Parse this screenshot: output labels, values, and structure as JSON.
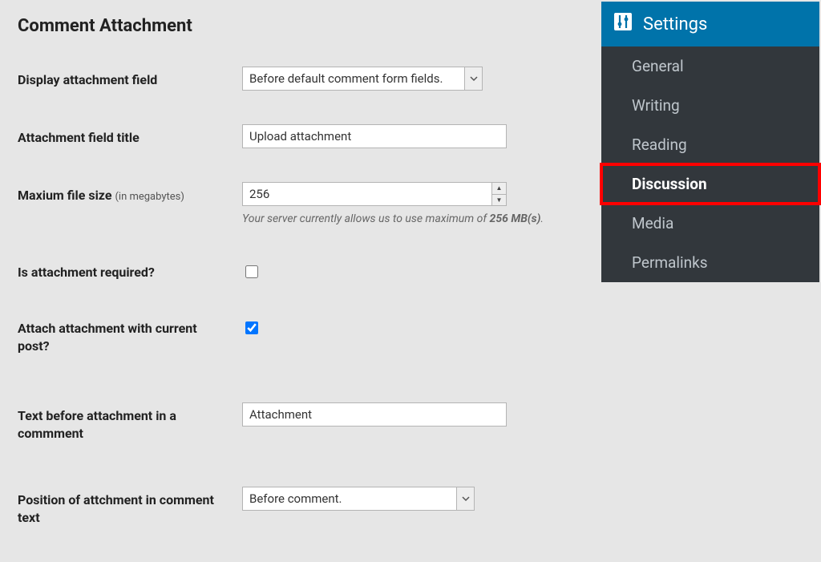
{
  "page_title": "Comment Attachment",
  "fields": {
    "display_field": {
      "label": "Display attachment field",
      "selected": "Before default comment form fields."
    },
    "field_title": {
      "label": "Attachment field title",
      "value": "Upload attachment"
    },
    "max_size": {
      "label": "Maxium file size",
      "sublabel": "(in megabytes)",
      "value": "256",
      "help_prefix": "Your server currently allows us to use maximum of ",
      "help_bold": "256 MB(s)",
      "help_suffix": "."
    },
    "required": {
      "label": "Is attachment required?",
      "checked": false
    },
    "attach_post": {
      "label": "Attach attachment with current post?",
      "checked": true
    },
    "text_before": {
      "label": "Text before attachment in a commment",
      "value": "Attachment"
    },
    "position": {
      "label": "Position of attchment in comment text",
      "selected": "Before comment."
    }
  },
  "sidebar": {
    "header": "Settings",
    "items": [
      {
        "label": "General",
        "highlighted": false
      },
      {
        "label": "Writing",
        "highlighted": false
      },
      {
        "label": "Reading",
        "highlighted": false
      },
      {
        "label": "Discussion",
        "highlighted": true
      },
      {
        "label": "Media",
        "highlighted": false
      },
      {
        "label": "Permalinks",
        "highlighted": false
      }
    ]
  }
}
